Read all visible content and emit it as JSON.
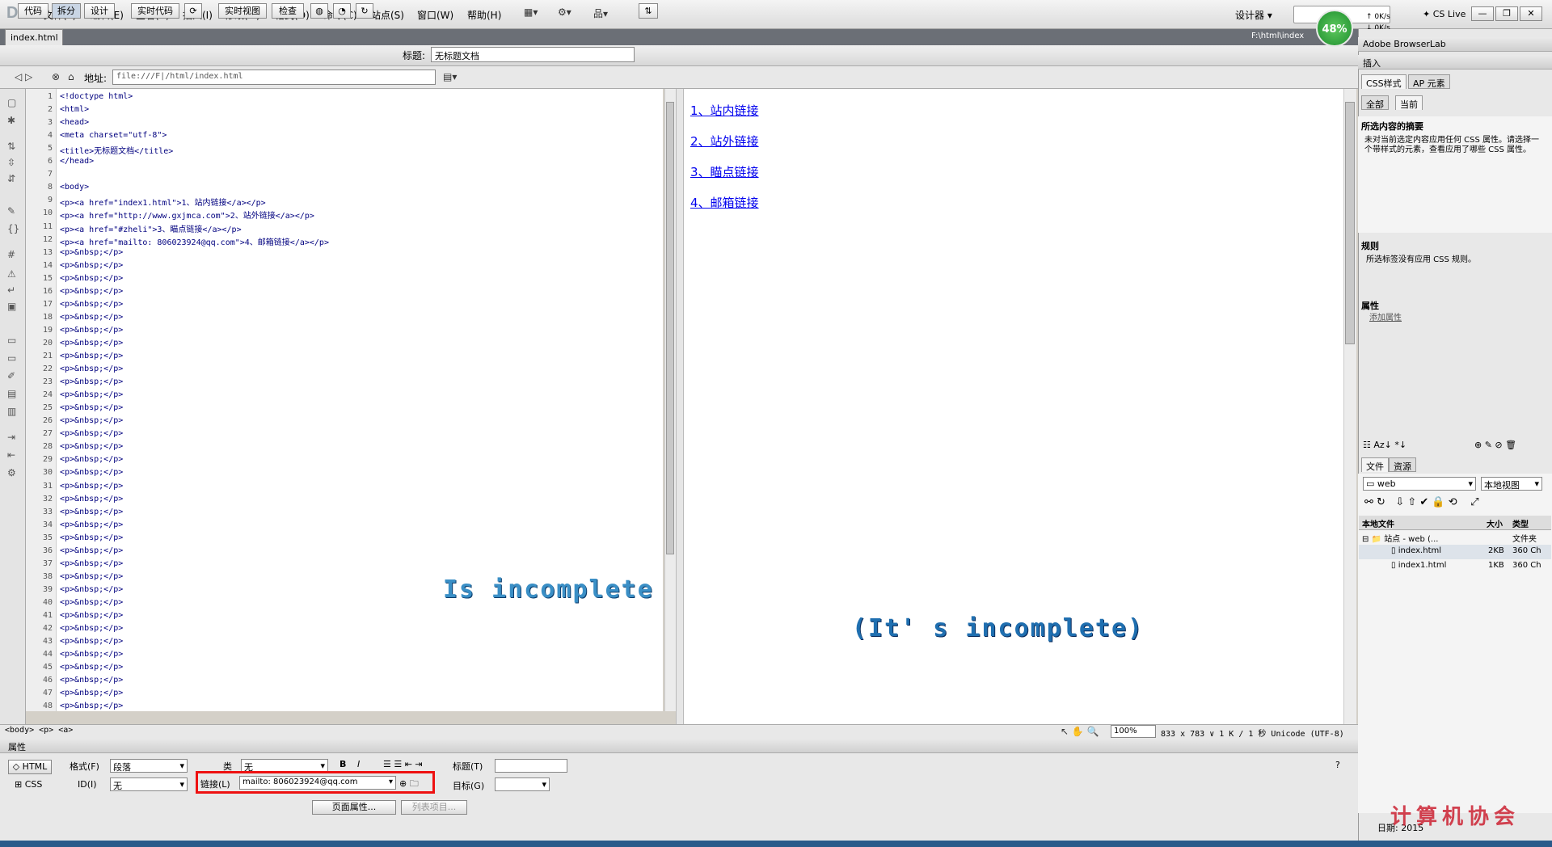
{
  "app": {
    "logo": "Dw",
    "workspace": "设计器",
    "cs_live": "CS Live",
    "progress": "48%",
    "upload_speed": "0K/s",
    "download_speed": "0K/s"
  },
  "menu": [
    "文件(F)",
    "编辑(E)",
    "查看(V)",
    "插入(I)",
    "修改(M)",
    "格式(O)",
    "命令(C)",
    "站点(S)",
    "窗口(W)",
    "帮助(H)"
  ],
  "tab": {
    "filename": "index.html",
    "path": "F:\\html\\index"
  },
  "toolbar": {
    "code": "代码",
    "split": "拆分",
    "design": "设计",
    "live_code": "实时代码",
    "live_view": "实时视图",
    "inspect": "检查",
    "title_label": "标题:",
    "title_value": "无标题文档"
  },
  "address": {
    "label": "地址:",
    "value": "file:///F|/html/index.html"
  },
  "code_lines": [
    "<!doctype html>",
    "<html>",
    "<head>",
    "<meta charset=\"utf-8\">",
    "<title>无标题文档</title>",
    "</head>",
    "",
    "<body>",
    "<p><a href=\"index1.html\">1、站内链接</a></p>",
    "<p><a href=\"http://www.gxjmca.com\">2、站外链接</a></p>",
    "<p><a href=\"#zheli\">3、瞄点链接</a></p>",
    "<p><a href=\"mailto: 806023924@qq.com\">4、邮箱链接</a></p>",
    "<p>&nbsp;</p>",
    "<p>&nbsp;</p>",
    "<p>&nbsp;</p>",
    "<p>&nbsp;</p>",
    "<p>&nbsp;</p>",
    "<p>&nbsp;</p>",
    "<p>&nbsp;</p>",
    "<p>&nbsp;</p>",
    "<p>&nbsp;</p>",
    "<p>&nbsp;</p>",
    "<p>&nbsp;</p>",
    "<p>&nbsp;</p>",
    "<p>&nbsp;</p>",
    "<p>&nbsp;</p>",
    "<p>&nbsp;</p>",
    "<p>&nbsp;</p>",
    "<p>&nbsp;</p>",
    "<p>&nbsp;</p>",
    "<p>&nbsp;</p>",
    "<p>&nbsp;</p>",
    "<p>&nbsp;</p>",
    "<p>&nbsp;</p>",
    "<p>&nbsp;</p>",
    "<p>&nbsp;</p>",
    "<p>&nbsp;</p>",
    "<p>&nbsp;</p>",
    "<p>&nbsp;</p>",
    "<p>&nbsp;</p>",
    "<p>&nbsp;</p>",
    "<p>&nbsp;</p>",
    "<p>&nbsp;</p>",
    "<p>&nbsp;</p>",
    "<p>&nbsp;</p>",
    "<p>&nbsp;</p>",
    "<p>&nbsp;</p>",
    "<p>&nbsp;</p>"
  ],
  "design_links": [
    "1、站内链接",
    "2、站外链接",
    "3、瞄点链接",
    "4、邮箱链接"
  ],
  "overlays": {
    "code": "Is incomplete",
    "design": "(It' s incomplete)"
  },
  "status": {
    "tag_selector": "<body> <p> <a>",
    "zoom": "100%",
    "dims": "833 x 783 ∨  1 K / 1 秒  Unicode (UTF-8)"
  },
  "properties": {
    "header": "属性",
    "html": "HTML",
    "css": "CSS",
    "format_label": "格式(F)",
    "format_value": "段落",
    "id_label": "ID(I)",
    "id_value": "无",
    "class_label": "类",
    "class_value": "无",
    "title_label": "标题(T)",
    "title_value": "",
    "link_label": "链接(L)",
    "link_value": "mailto: 806023924@qq.com",
    "target_label": "目标(G)",
    "target_value": "",
    "page_props": "页面属性...",
    "list_item": "列表项目..."
  },
  "right_panel": {
    "browserlab": "Adobe BrowserLab",
    "insert": "插入",
    "css_tab": "CSS样式",
    "ap_tab": "AP 元素",
    "all": "全部",
    "current": "当前",
    "summary_title": "所选内容的摘要",
    "summary_text": "未对当前选定内容应用任何 CSS 属性。请选择一个带样式的元素，查看应用了哪些 CSS 属性。",
    "rules_title": "规则",
    "rules_text": "所选标签没有应用 CSS 规则。",
    "props_title": "属性",
    "add_prop": "添加属性",
    "files_tab": "文件",
    "assets_tab": "资源",
    "site": "web",
    "view": "本地视图",
    "col_local": "本地文件",
    "col_size": "大小",
    "col_type": "类型",
    "files": [
      {
        "name": "站点 - web (...",
        "size": "",
        "type": "文件夹"
      },
      {
        "name": "index.html",
        "size": "2KB",
        "type": "360 Ch"
      },
      {
        "name": "index1.html",
        "size": "1KB",
        "type": "360 Ch"
      }
    ],
    "date_label": "日期: 2015"
  },
  "corner_logo": "计算机协会"
}
